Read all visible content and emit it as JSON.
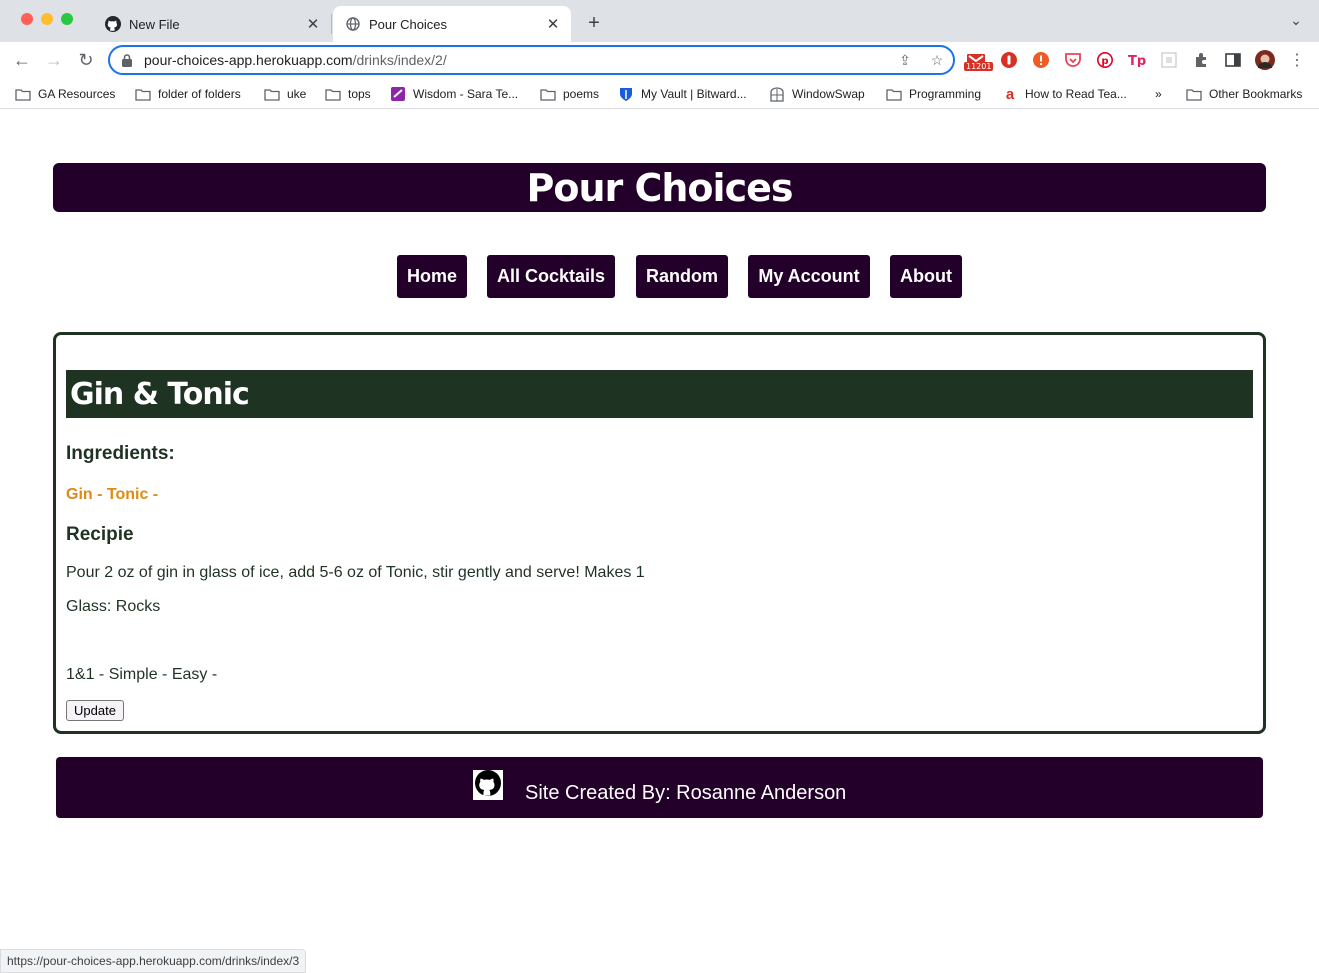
{
  "browser": {
    "tabs": [
      {
        "title": "New File",
        "favicon": "github-icon",
        "active": false
      },
      {
        "title": "Pour Choices",
        "favicon": "globe-icon",
        "active": true
      }
    ],
    "url_host": "pour-choices-app.herokuapp.com",
    "url_path": "/drinks/index/2/",
    "extension_badge": "11201",
    "bookmarks": [
      {
        "label": "GA Resources",
        "icon": "folder-icon"
      },
      {
        "label": "folder of folders",
        "icon": "folder-icon"
      },
      {
        "label": "uke",
        "icon": "folder-icon"
      },
      {
        "label": "tops",
        "icon": "folder-icon"
      },
      {
        "label": "Wisdom - Sara Te...",
        "icon": "app-icon"
      },
      {
        "label": "poems",
        "icon": "folder-icon"
      },
      {
        "label": "My Vault | Bitward...",
        "icon": "shield-icon"
      },
      {
        "label": "WindowSwap",
        "icon": "window-icon"
      },
      {
        "label": "Programming",
        "icon": "folder-icon"
      },
      {
        "label": "How to Read Tea...",
        "icon": "a-logo-icon"
      }
    ],
    "bookmarks_overflow": "»",
    "other_bookmarks": "Other Bookmarks",
    "status_url": "https://pour-choices-app.herokuapp.com/drinks/index/3"
  },
  "site": {
    "title": "Pour Choices",
    "nav": [
      {
        "label": "Home"
      },
      {
        "label": "All Cocktails"
      },
      {
        "label": "Random"
      },
      {
        "label": "My Account"
      },
      {
        "label": "About"
      }
    ]
  },
  "drink": {
    "name": "Gin & Tonic",
    "ingredients_heading": "Ingredients:",
    "ingredients": "Gin - Tonic -",
    "recipe_heading": "Recipie",
    "recipe": "Pour 2 oz of gin in glass of ice, add 5-6 oz of Tonic, stir gently and serve! Makes 1",
    "glass": "Glass: Rocks",
    "tags": "1&1 - Simple - Easy -",
    "update_label": "Update"
  },
  "footer": {
    "credit": "Site Created By: Rosanne Anderson",
    "icon": "github-icon"
  },
  "colors": {
    "primary": "#22002a",
    "card_green": "#1f3323",
    "ingredient_orange": "#df8a12"
  }
}
